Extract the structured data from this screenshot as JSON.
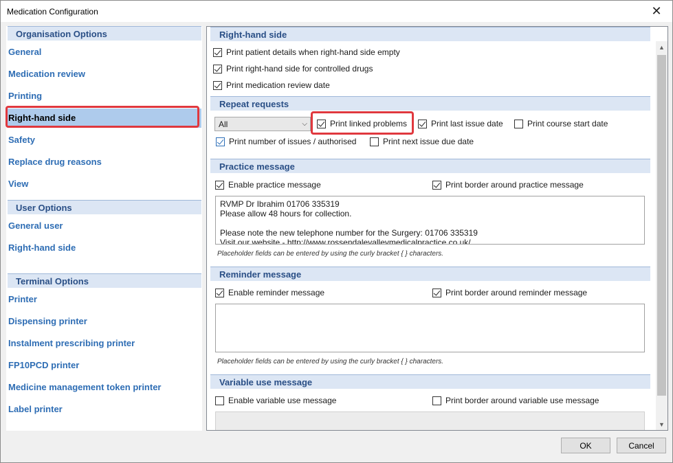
{
  "window": {
    "title": "Medication Configuration",
    "close_glyph": "✕"
  },
  "leftnav": {
    "organisation": {
      "heading": "Organisation Options",
      "items": [
        "General",
        "Medication review",
        "Printing",
        "Right-hand side",
        "Safety",
        "Replace drug reasons",
        "View"
      ],
      "selected": "Right-hand side"
    },
    "user": {
      "heading": "User Options",
      "items": [
        "General user",
        "Right-hand side"
      ]
    },
    "terminal": {
      "heading": "Terminal Options",
      "items": [
        "Printer",
        "Dispensing printer",
        "Instalment prescribing printer",
        "FP10PCD printer",
        "Medicine management token printer",
        "Label printer"
      ]
    }
  },
  "rhs": {
    "heading": "Right-hand side",
    "opts": [
      {
        "label": "Print patient details when right-hand side empty",
        "checked": true
      },
      {
        "label": "Print right-hand side for controlled drugs",
        "checked": true
      },
      {
        "label": "Print medication review date",
        "checked": true
      }
    ]
  },
  "repeat": {
    "heading": "Repeat requests",
    "select_value": "All",
    "opts": [
      {
        "label": "Print linked problems",
        "checked": true
      },
      {
        "label": "Print last issue date",
        "checked": true
      },
      {
        "label": "Print course start date",
        "checked": false
      },
      {
        "label": "Print number of issues / authorised",
        "checked": true
      },
      {
        "label": "Print next issue due date",
        "checked": false
      }
    ]
  },
  "practice": {
    "heading": "Practice message",
    "enable": {
      "label": "Enable practice message",
      "checked": true
    },
    "border": {
      "label": "Print border around practice message",
      "checked": true
    },
    "lines": [
      "RVMP Dr Ibrahim 01706 335319",
      "Please allow 48 hours for collection.",
      "",
      "Please note the new telephone number for the Surgery: 01706 335319",
      "Visit our website - http://www.rossendalevalleymedicalpractice.co.uk/"
    ],
    "hint": "Placeholder fields can be entered by using the curly bracket { } characters."
  },
  "reminder": {
    "heading": "Reminder message",
    "enable": {
      "label": "Enable reminder message",
      "checked": true
    },
    "border": {
      "label": "Print border around reminder message",
      "checked": true
    },
    "hint": "Placeholder fields can be entered by using the curly bracket { } characters."
  },
  "variable": {
    "heading": "Variable use message",
    "enable": {
      "label": "Enable variable use message",
      "checked": false
    },
    "border": {
      "label": "Print border around variable use message",
      "checked": false
    }
  },
  "buttons": {
    "ok": "OK",
    "cancel": "Cancel"
  },
  "colors": {
    "highlight": "#e0383e",
    "nav_link": "#2e6db4",
    "section_head": "#dce6f4",
    "selected": "#aecbec"
  }
}
